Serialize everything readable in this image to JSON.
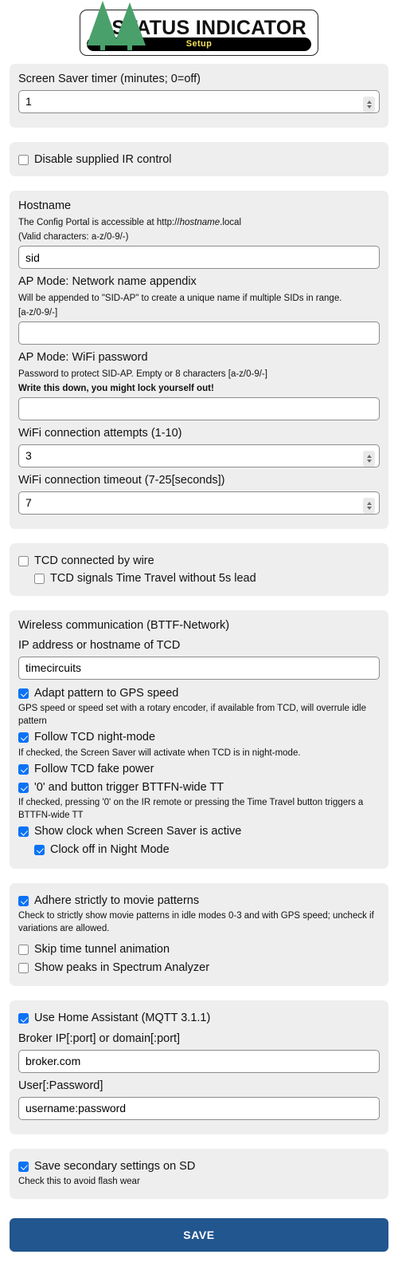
{
  "header": {
    "title": "STATUS INDICATOR",
    "banner_label": "Setup",
    "logo_icon": "two-pine-trees-icon",
    "logo_color": "#4aa06b",
    "banner_text_color": "#f1e05a"
  },
  "screensaver": {
    "label": "Screen Saver timer (minutes; 0=off)",
    "value": "1"
  },
  "ir": {
    "disable_label": "Disable supplied IR control",
    "disable_checked": false
  },
  "hostname": {
    "label": "Hostname",
    "hint_prefix": "The Config Portal is accessible at http://",
    "hint_italic": "hostname",
    "hint_suffix": ".local",
    "valid_chars": "(Valid characters: a-z/0-9/-)",
    "value": "sid",
    "ap_name_label": "AP Mode: Network name appendix",
    "ap_name_hint_1": "Will be appended to \"SID-AP\" to create a unique name if multiple SIDs in range.",
    "ap_name_hint_2": "[a-z/0-9/-]",
    "ap_name_value": "",
    "ap_pw_label": "AP Mode: WiFi password",
    "ap_pw_hint": "Password to protect SID-AP. Empty or 8 characters [a-z/0-9/-]",
    "ap_pw_warning": "Write this down, you might lock yourself out!",
    "ap_pw_value": "",
    "attempts_label": "WiFi connection attempts (1-10)",
    "attempts_value": "3",
    "timeout_label": "WiFi connection timeout (7-25[seconds])",
    "timeout_value": "7"
  },
  "tcd_wire": {
    "connected_label": "TCD connected by wire",
    "connected_checked": false,
    "no_lead_label": "TCD signals Time Travel without 5s lead",
    "no_lead_checked": false
  },
  "wireless": {
    "heading": "Wireless communication (BTTF-Network)",
    "tcd_ip_label": "IP address or hostname of TCD",
    "tcd_ip_value": "timecircuits",
    "gps_label": "Adapt pattern to GPS speed",
    "gps_checked": true,
    "gps_hint": "GPS speed or speed set with a rotary encoder, if available from TCD, will overrule idle pattern",
    "night_label": "Follow TCD night-mode",
    "night_checked": true,
    "night_hint": "If checked, the Screen Saver will activate when TCD is in night-mode.",
    "fakepower_label": "Follow TCD fake power",
    "fakepower_checked": true,
    "bttfn_tt_label": "'0' and button trigger BTTFN-wide TT",
    "bttfn_tt_checked": true,
    "bttfn_tt_hint": "If checked, pressing '0' on the IR remote or pressing the Time Travel button triggers a BTTFN-wide TT",
    "clock_label": "Show clock when Screen Saver is active",
    "clock_checked": true,
    "clock_night_label": "Clock off in Night Mode",
    "clock_night_checked": true
  },
  "patterns": {
    "adhere_label": "Adhere strictly to movie patterns",
    "adhere_checked": true,
    "adhere_hint": "Check to strictly show movie patterns in idle modes 0-3 and with GPS speed; uncheck if variations are allowed.",
    "skip_tunnel_label": "Skip time tunnel animation",
    "skip_tunnel_checked": false,
    "show_peaks_label": "Show peaks in Spectrum Analyzer",
    "show_peaks_checked": false
  },
  "home_assistant": {
    "use_label": "Use Home Assistant (MQTT 3.1.1)",
    "use_checked": true,
    "broker_label": "Broker IP[:port] or domain[:port]",
    "broker_value": "broker.com",
    "user_label": "User[:Password]",
    "user_value": "username:password"
  },
  "sd": {
    "save_label": "Save secondary settings on SD",
    "save_checked": true,
    "hint": "Check this to avoid flash wear"
  },
  "footer": {
    "save_button": "SAVE",
    "save_button_color": "#22568f"
  }
}
